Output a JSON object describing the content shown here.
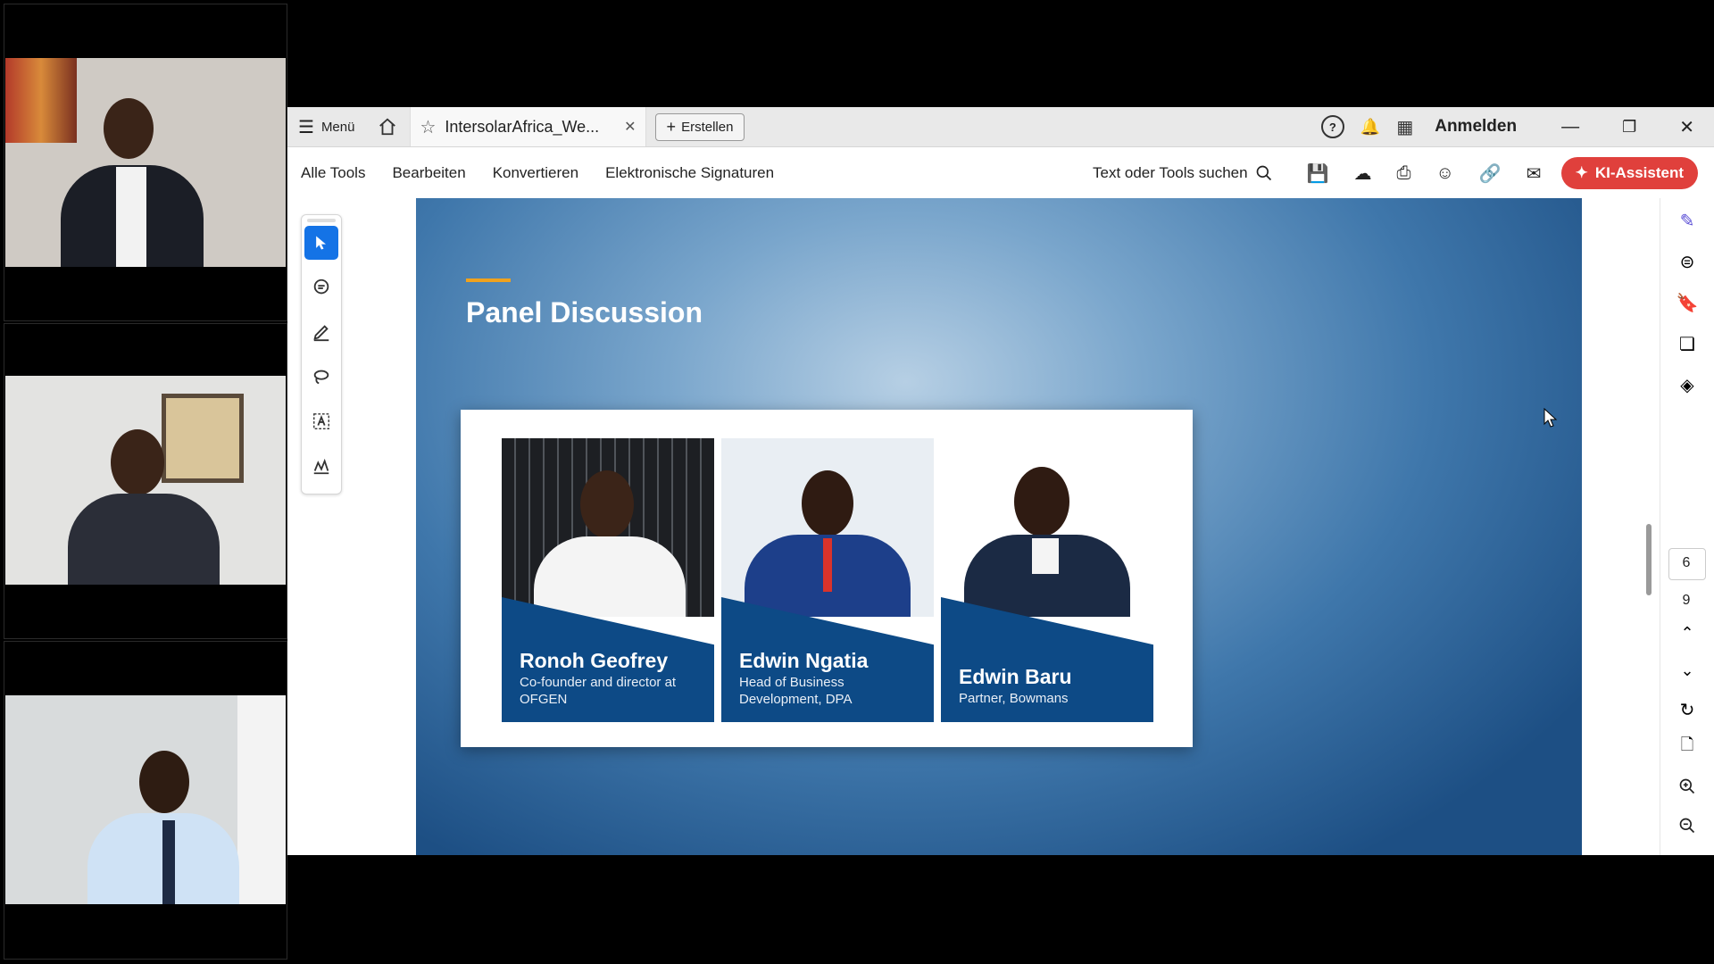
{
  "window": {
    "menu_label": "Menü",
    "tab_title": "IntersolarAfrica_We...",
    "create_label": "Erstellen",
    "signin_label": "Anmelden"
  },
  "menubar": {
    "items": [
      "Alle Tools",
      "Bearbeiten",
      "Konvertieren",
      "Elektronische Signaturen"
    ],
    "search_label": "Text oder Tools suchen",
    "ai_label": "KI-Assistent"
  },
  "page_nav": {
    "current_page": "6",
    "total_pages": "9"
  },
  "slide": {
    "title": "Panel Discussion",
    "speakers": [
      {
        "name": "Ronoh Geofrey",
        "role": "Co-founder and director at OFGEN"
      },
      {
        "name": "Edwin Ngatia",
        "role": "Head of Business Development, DPA"
      },
      {
        "name": "Edwin Baru",
        "role": "Partner, Bowmans"
      }
    ]
  },
  "colors": {
    "accent_ai": "#e0403c",
    "slide_blue": "#0d4a86",
    "title_rule": "#f0a21e",
    "tool_selected": "#1473e6"
  }
}
